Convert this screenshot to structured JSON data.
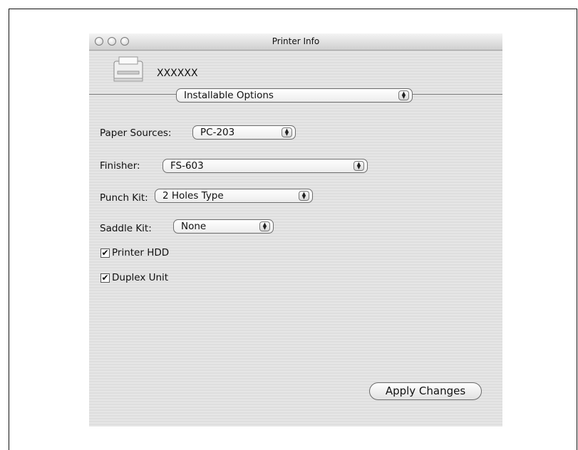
{
  "window": {
    "title": "Printer Info"
  },
  "printer": {
    "name": "XXXXXX"
  },
  "section_popup": {
    "value": "Installable Options"
  },
  "options": {
    "paper_sources": {
      "label": "Paper Sources:",
      "value": "PC-203"
    },
    "finisher": {
      "label": "Finisher:",
      "value": "FS-603"
    },
    "punch_kit": {
      "label": "Punch Kit:",
      "value": "2 Holes Type"
    },
    "saddle_kit": {
      "label": "Saddle Kit:",
      "value": "None"
    }
  },
  "checkboxes": {
    "printer_hdd": {
      "label": "Printer HDD",
      "checked": true,
      "mark": "✔"
    },
    "duplex_unit": {
      "label": "Duplex Unit",
      "checked": true,
      "mark": "✔"
    }
  },
  "buttons": {
    "apply": "Apply Changes"
  },
  "icons": {
    "close": "close-icon",
    "minimize": "minimize-icon",
    "zoom": "zoom-icon",
    "printer": "printer-icon",
    "popup_arrows": "up-down-arrows-icon"
  }
}
